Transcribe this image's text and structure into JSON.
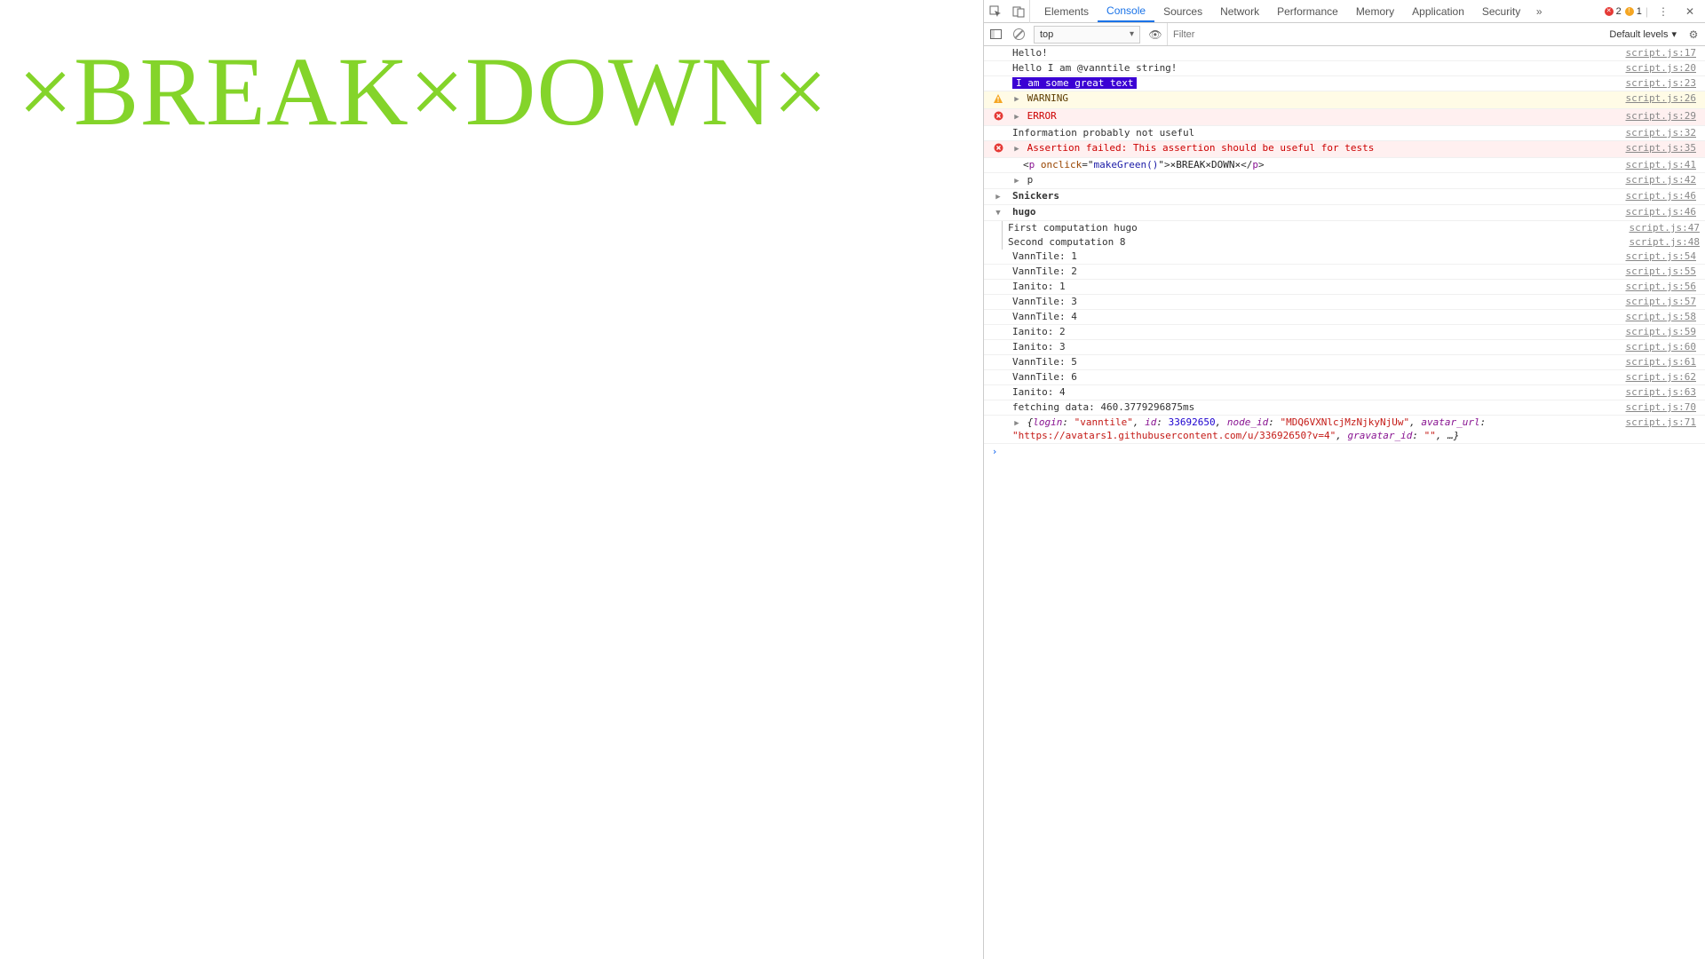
{
  "page": {
    "breakdown_text": "×BREAK×DOWN×"
  },
  "devtools": {
    "tabs": [
      "Elements",
      "Console",
      "Sources",
      "Network",
      "Performance",
      "Memory",
      "Application",
      "Security"
    ],
    "active_tab": "Console",
    "counts": {
      "errors": 2,
      "warnings": 1
    },
    "toolbar": {
      "context": "top",
      "filter_placeholder": "Filter",
      "levels_label": "Default levels"
    },
    "logs": [
      {
        "type": "log",
        "msg": "Hello!",
        "src": "script.js:17"
      },
      {
        "type": "log",
        "msg": "Hello I am @vanntile string!",
        "src": "script.js:20"
      },
      {
        "type": "styled",
        "msg": "I am some great text",
        "src": "script.js:23"
      },
      {
        "type": "warn",
        "expandable": true,
        "msg": "WARNING",
        "src": "script.js:26"
      },
      {
        "type": "err",
        "expandable": true,
        "msg": "ERROR",
        "src": "script.js:29"
      },
      {
        "type": "log",
        "msg": "Information probably not useful",
        "src": "script.js:32"
      },
      {
        "type": "assert",
        "expandable": true,
        "msg": "Assertion failed: This assertion should be useful for tests",
        "src": "script.js:35"
      },
      {
        "type": "html",
        "indent": 1,
        "html": {
          "tag": "p",
          "attr": "onclick",
          "attrval": "makeGreen()",
          "text": "×BREAK×DOWN×"
        },
        "src": "script.js:41"
      },
      {
        "type": "node",
        "indent": 0,
        "expandable": true,
        "msg": "p",
        "src": "script.js:42"
      },
      {
        "type": "group-closed",
        "msg": "Snickers",
        "src": "script.js:46"
      },
      {
        "type": "group-open",
        "msg": "hugo",
        "src": "script.js:46",
        "children": [
          {
            "msg": "First computation hugo",
            "src": "script.js:47"
          },
          {
            "msg": "Second computation 8",
            "src": "script.js:48"
          }
        ]
      },
      {
        "type": "log",
        "msg": "VannTile: 1",
        "src": "script.js:54"
      },
      {
        "type": "log",
        "msg": "VannTile: 2",
        "src": "script.js:55"
      },
      {
        "type": "log",
        "msg": "Ianito: 1",
        "src": "script.js:56"
      },
      {
        "type": "log",
        "msg": "VannTile: 3",
        "src": "script.js:57"
      },
      {
        "type": "log",
        "msg": "VannTile: 4",
        "src": "script.js:58"
      },
      {
        "type": "log",
        "msg": "Ianito: 2",
        "src": "script.js:59"
      },
      {
        "type": "log",
        "msg": "Ianito: 3",
        "src": "script.js:60"
      },
      {
        "type": "log",
        "msg": "VannTile: 5",
        "src": "script.js:61"
      },
      {
        "type": "log",
        "msg": "VannTile: 6",
        "src": "script.js:62"
      },
      {
        "type": "log",
        "msg": "Ianito: 4",
        "src": "script.js:63"
      },
      {
        "type": "log",
        "msg": "fetching data: 460.3779296875ms",
        "src": "script.js:70"
      },
      {
        "type": "obj",
        "expandable": true,
        "src": "script.js:71",
        "obj": {
          "login": "\"vanntile\"",
          "id": "33692650",
          "node_id": "\"MDQ6VXNlcjMzNjkyNjUw\"",
          "avatar_url": "\"https://avatars1.githubusercontent.com/u/33692650?v=4\"",
          "gravatar_id": "\"\""
        }
      }
    ]
  }
}
